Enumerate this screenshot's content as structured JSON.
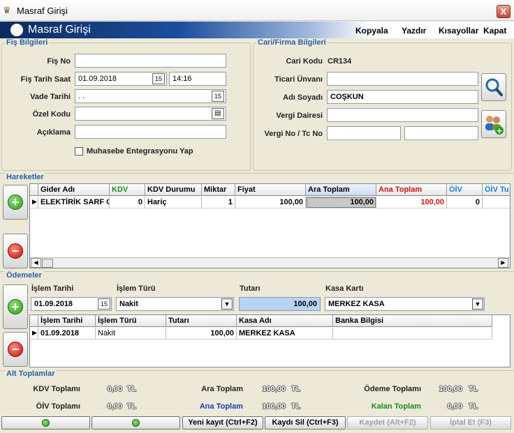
{
  "window": {
    "title": "Masraf Girişi",
    "close_label": "X"
  },
  "header": {
    "title": "Masraf Girişi",
    "menu": [
      "Kopyala",
      "Yazdır",
      "Kısayollar",
      "Kapat"
    ]
  },
  "fis": {
    "group_title": "Fiş Bilgileri",
    "fis_no_label": "Fiş No",
    "fis_no_value": "",
    "tarih_label": "Fiş Tarih Saat",
    "tarih_value": "01.09.2018",
    "saat_value": "14:16",
    "vade_label": "Vade Tarihi",
    "vade_value": ". .",
    "ozel_label": "Özel Kodu",
    "ozel_value": "",
    "aciklama_label": "Açıklama",
    "aciklama_value": "",
    "muhasebe_label": "Muhasebe Entegrasyonu Yap",
    "cal_glyph": "15"
  },
  "cari": {
    "group_title": "Cari/Firma Bilgileri",
    "cari_kodu_label": "Cari Kodu",
    "cari_kodu_value": "CR134",
    "ticari_label": "Ticari Ünvanı",
    "ticari_value": "",
    "adi_label": "Adı Soyadı",
    "adi_value": "COŞKUN",
    "vergi_dairesi_label": "Vergi Dairesi",
    "vergi_dairesi_value": "",
    "vergi_no_label": "Vergi No / Tc No",
    "vergi_no_value": "",
    "tc_no_value": ""
  },
  "hareketler": {
    "title": "Hareketler",
    "columns": [
      "Gider Adı",
      "KDV",
      "KDV Durumu",
      "Miktar",
      "Fiyat",
      "Ara Toplam",
      "Ana Toplam",
      "ÖİV",
      "ÖİV Tu"
    ],
    "rows": [
      {
        "gider": "ELEKTİRİK SARF G",
        "kdv": "0",
        "kdv_durumu": "Hariç",
        "miktar": "1",
        "fiyat": "100,00",
        "ara": "100,00",
        "ana": "100,00",
        "oiv": "0",
        "oiv_tu": ""
      }
    ]
  },
  "odemeler": {
    "title": "Ödemeler",
    "islem_tarihi_label": "İşlem Tarihi",
    "islem_tarihi_value": "01.09.2018",
    "islem_turu_label": "İşlem Türü",
    "islem_turu_value": "Nakit",
    "tutari_label": "Tutarı",
    "tutari_value": "100,00",
    "kasa_label": "Kasa Kartı",
    "kasa_value": "MERKEZ KASA",
    "columns": [
      "İşlem Tarihi",
      "İşlem Türü",
      "Tutarı",
      "Kasa Adı",
      "Banka Bilgisi"
    ],
    "rows": [
      {
        "tarih": "01.09.2018",
        "tur": "Nakit",
        "tutar": "100,00",
        "kasa": "MERKEZ KASA",
        "banka": ""
      }
    ]
  },
  "alt": {
    "title": "Alt Toplamlar",
    "kdv_label": "KDV Toplamı",
    "kdv_value": "0,00",
    "oiv_label": "ÖİV Toplamı",
    "oiv_value": "0,00",
    "ara_label": "Ara Toplam",
    "ara_value": "100,00",
    "ana_label": "Ana Toplam",
    "ana_value": "100,00",
    "odeme_label": "Ödeme Toplamı",
    "odeme_value": "100,00",
    "kalan_label": "Kalan Toplam",
    "kalan_value": "0,00",
    "currency": "TL"
  },
  "buttons": {
    "yeni": "Yeni kayıt (Ctrl+F2)",
    "sil": "Kaydı Sil (Ctrl+F3)",
    "kaydet": "Kaydet (Alt+F2)",
    "iptal": "İptal Et (F3)"
  },
  "colors": {
    "group_title": "#2c5ea8",
    "kdv_header": "#1a8c1a",
    "ana_header": "#d01010",
    "oiv_header": "#1a7ad0",
    "ana_total_label": "#1c3ea8",
    "kalan_label": "#1a8c1a",
    "tutar_fill": "#b8d4f4"
  }
}
